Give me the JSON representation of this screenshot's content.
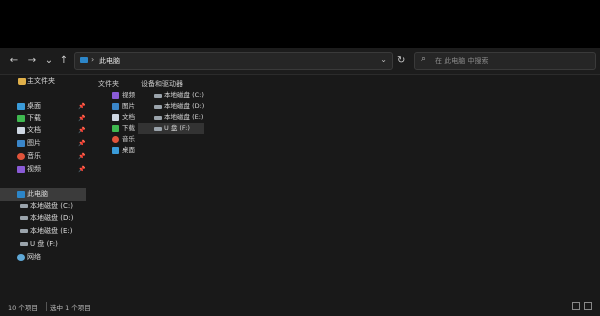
{
  "toolbar": {
    "back_icon": "←",
    "forward_icon": "→",
    "recent_icon": "⌄",
    "up_icon": "↑",
    "address_separator": "›",
    "address_path": "此电脑",
    "address_dropdown": "⌄",
    "refresh_icon": "↻",
    "search_icon": "⌕",
    "search_placeholder": "在 此电脑 中搜索"
  },
  "sidebar": {
    "home_label": "主文件夹",
    "pinned": [
      {
        "label": "桌面",
        "icon": "desktop-icon",
        "color": "#3a9bd9",
        "pin": "📌"
      },
      {
        "label": "下载",
        "icon": "download-icon",
        "color": "#3fb950",
        "pin": "📌"
      },
      {
        "label": "文档",
        "icon": "document-icon",
        "color": "#cfd8e3",
        "pin": "📌"
      },
      {
        "label": "图片",
        "icon": "pictures-icon",
        "color": "#3a86c9",
        "pin": "📌"
      },
      {
        "label": "音乐",
        "icon": "music-icon",
        "color": "#e0533a",
        "pin": "📌"
      },
      {
        "label": "视频",
        "icon": "video-icon",
        "color": "#8a5bd6",
        "pin": "📌"
      }
    ],
    "this_pc_label": "此电脑",
    "drives": [
      {
        "label": "本地磁盘 (C:)"
      },
      {
        "label": "本地磁盘 (D:)"
      },
      {
        "label": "本地磁盘 (E:)"
      },
      {
        "label": "U 盘 (F:)"
      }
    ],
    "network_label": "网络"
  },
  "main": {
    "folders_title": "文件夹",
    "folders": [
      {
        "label": "视频",
        "icon": "video-icon",
        "color": "#8a5bd6"
      },
      {
        "label": "图片",
        "icon": "pictures-icon",
        "color": "#3a86c9"
      },
      {
        "label": "文档",
        "icon": "document-icon",
        "color": "#cfd8e3"
      },
      {
        "label": "下载",
        "icon": "download-icon",
        "color": "#3fb950"
      },
      {
        "label": "音乐",
        "icon": "music-icon",
        "color": "#e0533a"
      },
      {
        "label": "桌面",
        "icon": "desktop-icon",
        "color": "#3a9bd9"
      }
    ],
    "devices_title": "设备和驱动器",
    "devices": [
      {
        "label": "本地磁盘 (C:)"
      },
      {
        "label": "本地磁盘 (D:)"
      },
      {
        "label": "本地磁盘 (E:)"
      },
      {
        "label": "U 盘 (F:)"
      }
    ]
  },
  "status": {
    "item_count": "10 个项目",
    "selected_count": "选中 1 个项目"
  }
}
